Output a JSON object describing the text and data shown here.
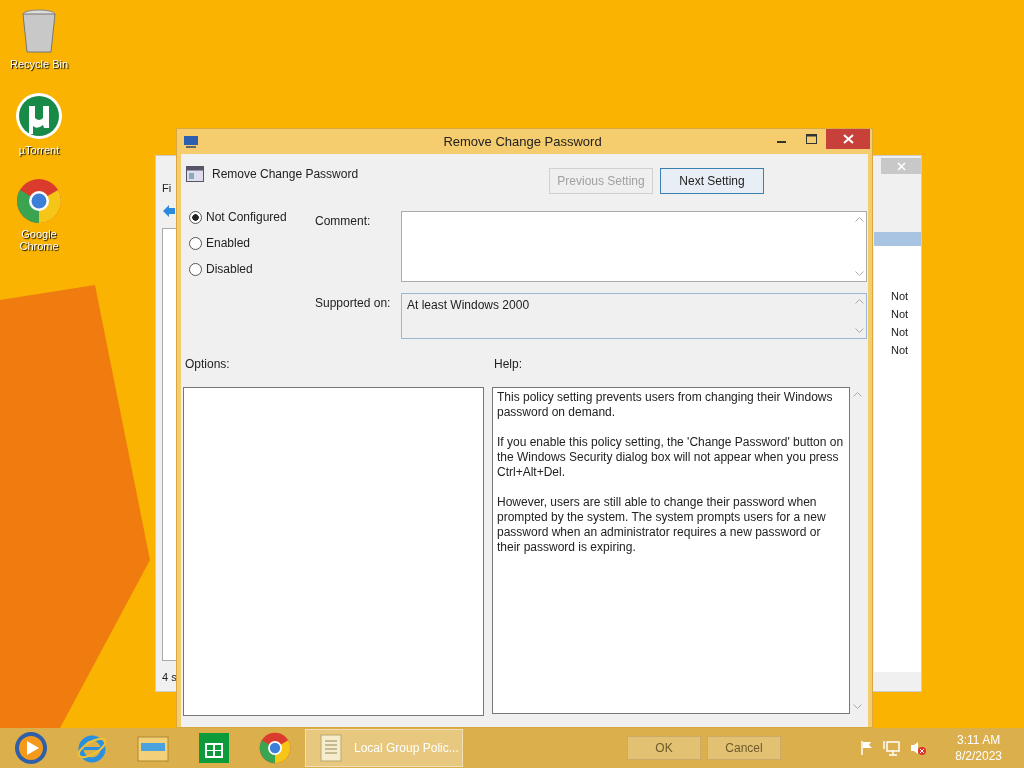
{
  "desktop": {
    "icons": [
      {
        "label": "Recycle Bin",
        "kind": "recycle"
      },
      {
        "label": "µTorrent",
        "kind": "utorrent"
      },
      {
        "label": "Google Chrome",
        "kind": "chrome"
      }
    ]
  },
  "background_window": {
    "menu": "Fi",
    "rows": [
      "Not",
      "Not",
      "Not",
      "Not"
    ],
    "status": "4 s"
  },
  "dialog": {
    "title": "Remove Change Password",
    "heading": "Remove Change Password",
    "nav_buttons": [
      {
        "label": "Previous Setting",
        "disabled": true
      },
      {
        "label": "Next Setting",
        "disabled": false
      }
    ],
    "states": [
      {
        "label": "Not Configured",
        "selected": true
      },
      {
        "label": "Enabled",
        "selected": false
      },
      {
        "label": "Disabled",
        "selected": false
      }
    ],
    "comment_label": "Comment:",
    "supported_label": "Supported on:",
    "supported_value": "At least Windows 2000",
    "options_label": "Options:",
    "help_label": "Help:",
    "help_paragraphs": [
      "This policy setting prevents users from changing their Windows password on demand.",
      "If you enable this policy setting,  the 'Change Password' button on the Windows Security dialog box will not appear when you press Ctrl+Alt+Del.",
      "However, users are still able to change their password when prompted by the system. The system prompts users for a new password when an administrator requires a new password or their password is expiring."
    ],
    "footer_buttons": [
      "OK",
      "Cancel"
    ]
  },
  "taskbar": {
    "pinned": [
      {
        "kind": "media"
      },
      {
        "kind": "ie"
      },
      {
        "kind": "explorer"
      },
      {
        "kind": "store"
      },
      {
        "kind": "chrome"
      }
    ],
    "active_task": "Local Group Polic...",
    "tray": {
      "time": "3:11 AM",
      "date": "8/2/2023"
    }
  }
}
